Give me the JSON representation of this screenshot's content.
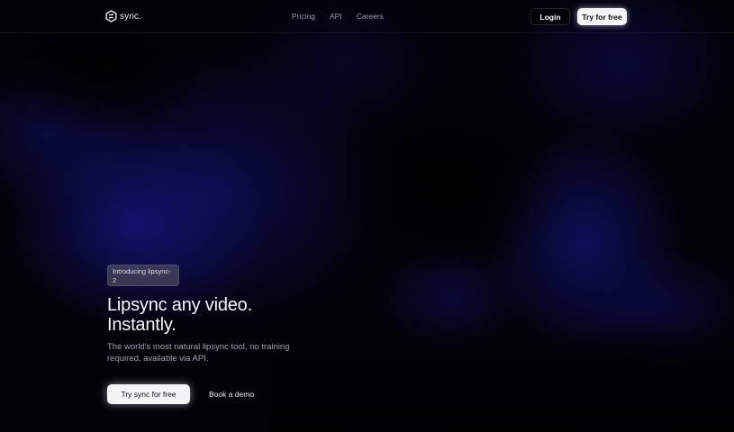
{
  "brand": {
    "name": "sync.",
    "logo_icon": "sync-logo-icon"
  },
  "nav": {
    "items": [
      {
        "label": "Pricing"
      },
      {
        "label": "API"
      },
      {
        "label": "Careers"
      }
    ]
  },
  "header_actions": {
    "login_label": "Login",
    "try_label": "Try for free"
  },
  "hero": {
    "badge": "Introducing lipsync-2",
    "headline_line1": "Lipsync any video.",
    "headline_line2": "Instantly.",
    "subtext": "The world's most natural lipsync tool, no training required, available via API.",
    "primary_cta": "Try sync for free",
    "secondary_cta": "Book a demo"
  },
  "colors": {
    "background": "#020208",
    "accent_glow": "#16148a",
    "button_light": "#f4f4f6",
    "muted_text": "#a3a3b3"
  }
}
